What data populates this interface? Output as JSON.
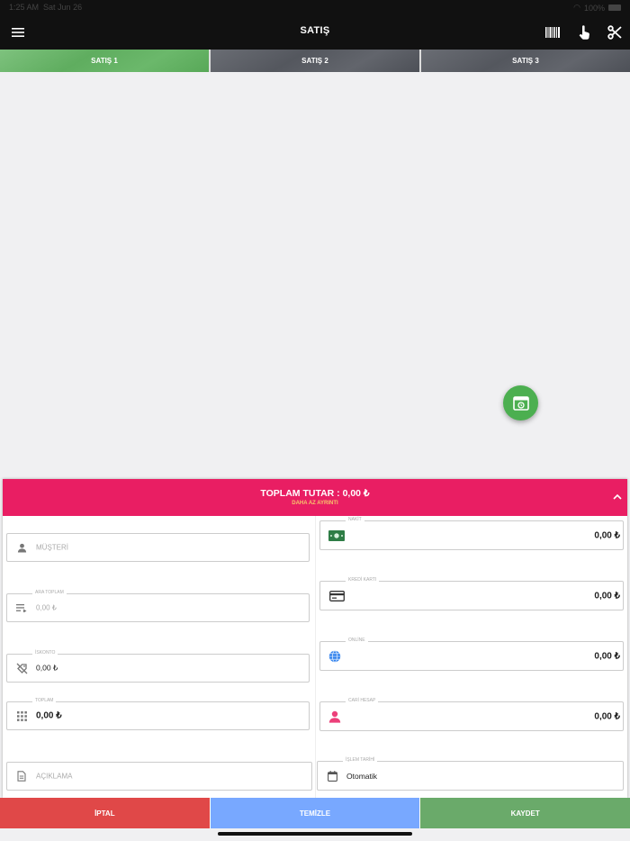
{
  "status": {
    "time": "1:25 AM",
    "date": "Sat Jun 26",
    "battery": "100%"
  },
  "header": {
    "title": "SATIŞ"
  },
  "icons": {
    "menu": "menu-icon",
    "barcode": "barcode-icon",
    "touch": "touch-icon",
    "scissors": "scissors-icon"
  },
  "tabs": [
    {
      "label": "SATIŞ 1",
      "active": true
    },
    {
      "label": "SATIŞ 2",
      "active": false
    },
    {
      "label": "SATIŞ 3",
      "active": false
    }
  ],
  "summary": {
    "total_label": "TOPLAM TUTAR : 0,00 ₺",
    "details_link": "DAHA AZ AYRINTI"
  },
  "left_fields": {
    "customer_placeholder": "MÜŞTERİ",
    "subtotal_label": "ARA TOPLAM",
    "subtotal_value": "0,00 ₺",
    "discount_label": "İSKONTO",
    "discount_value": "0,00 ₺",
    "total_label": "TOPLAM",
    "total_value": "0,00 ₺",
    "note_placeholder": "AÇIKLAMA"
  },
  "right_fields": {
    "cash_label": "NAKİT",
    "cash_value": "0,00 ₺",
    "card_label": "KREDİ KARTI",
    "card_value": "0,00 ₺",
    "online_label": "ONLİNE",
    "online_value": "0,00 ₺",
    "account_label": "CARİ HESAP",
    "account_value": "0,00 ₺",
    "date_label": "İŞLEM TARİHİ",
    "date_value": "Otomatik"
  },
  "actions": {
    "cancel": "İPTAL",
    "clear": "TEMİZLE",
    "save": "KAYDET"
  },
  "colors": {
    "accent": "#e91e63",
    "active_tab": "#5fad5f",
    "cancel": "#e04848",
    "clear": "#78a8ff",
    "save": "#6aaa6a"
  }
}
